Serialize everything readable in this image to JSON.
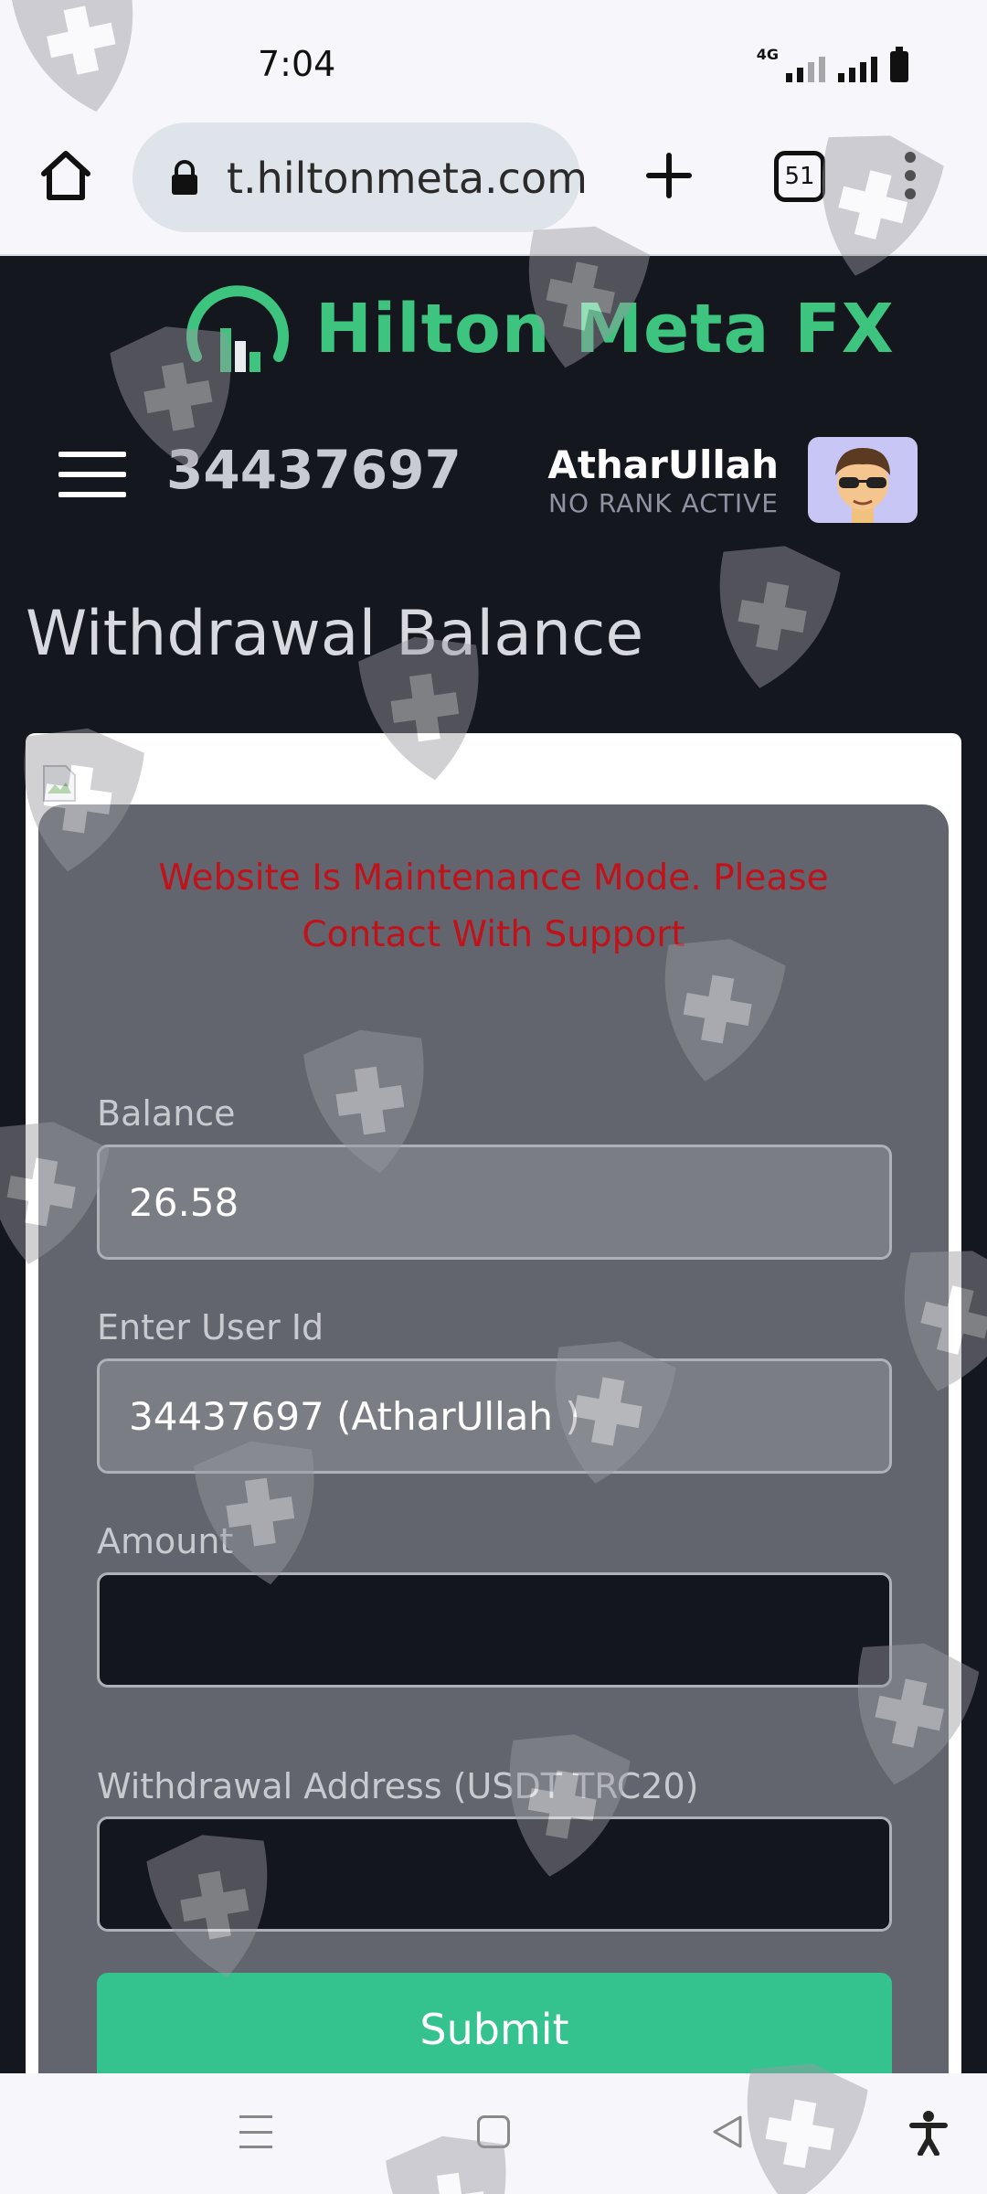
{
  "status_bar": {
    "time": "7:04",
    "network": "4G"
  },
  "browser": {
    "url": "t.hiltonmeta.com",
    "tab_count": "51"
  },
  "header": {
    "brand": "Hilton Meta FX",
    "user_id": "34437697",
    "username": "AtharUllah",
    "rank": "NO RANK ACTIVE"
  },
  "page": {
    "title": "Withdrawal Balance",
    "notice": "Website Is Maintenance Mode. Please Contact With Support"
  },
  "form": {
    "balance_label": "Balance",
    "balance_value": "26.58",
    "user_label": "Enter User Id",
    "user_value": "34437697 (AtharUllah )",
    "amount_label": "Amount",
    "amount_value": "",
    "address_label": "Withdrawal Address (USDT TRC20)",
    "address_value": "",
    "submit_label": "Submit"
  },
  "colors": {
    "brand_green": "#3dc47e",
    "notice_red": "#c0121a",
    "submit_green": "#34c38e",
    "page_bg": "#15171f"
  }
}
